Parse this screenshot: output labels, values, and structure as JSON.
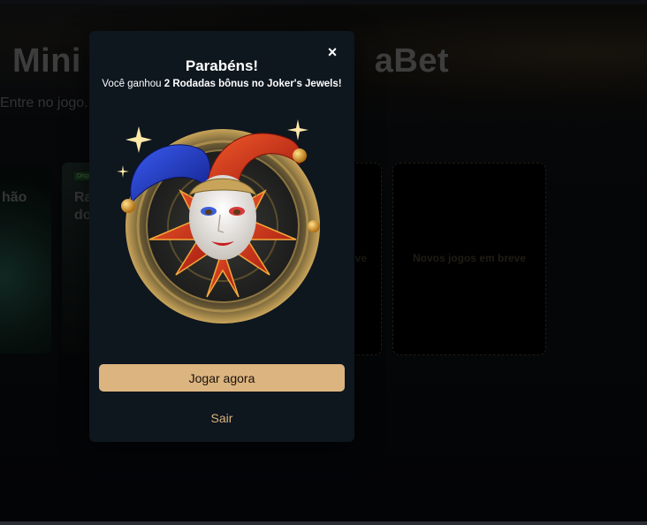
{
  "background": {
    "title": "Mini                              aBet",
    "subtitle": "Entre no jogo.                                            os exclusivos.",
    "cards": [
      {
        "label": "hão",
        "badge": ""
      },
      {
        "label": "Ra\ndo",
        "badge": "Disp"
      }
    ],
    "placeholders": [
      {
        "text": "breve"
      },
      {
        "text": "Novos jogos em breve"
      }
    ]
  },
  "modal": {
    "close_icon": "×",
    "title": "Parabéns!",
    "message_prefix": "Você ganhou ",
    "message_bold": "2 Rodadas bônus no Joker's Jewels!",
    "image_name": "jokers-jewels-jester-icon",
    "play_button": "Jogar agora",
    "exit_link": "Sair"
  },
  "colors": {
    "accent": "#dcb480",
    "modal_bg": "#0e161e",
    "link": "#d9b27c"
  }
}
